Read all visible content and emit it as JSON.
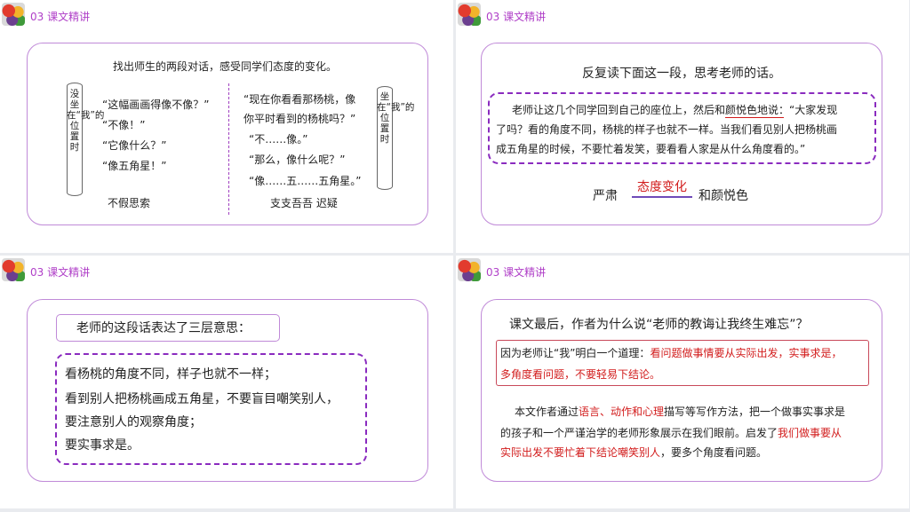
{
  "section_label": "03  课文精讲",
  "slide1": {
    "instruction": "找出师生的两段对话，感受同学们态度的变化。",
    "left_scroll": "没坐在“我”的位置时",
    "left_lines": [
      "“这幅画画得像不像？”",
      "“不像！”",
      "“它像什么？”",
      "“像五角星！”"
    ],
    "left_summary": "不假思索",
    "right_lines": [
      "“现在你看看那杨桃，像",
      "你平时看到的杨桃吗？”",
      "“不……像。”",
      "“那么，像什么呢？”",
      "“像……五……五角星。”"
    ],
    "right_scroll": "坐在“我”的位置时",
    "right_summary": "支支吾吾 迟疑"
  },
  "slide2": {
    "question": "反复读下面这一段，思考老师的话。",
    "para_lines": [
      "老师让这几个同学回到自己的座位上，然后和颜悦色地说：“大家发现",
      "了吗？看的角度不同，杨桃的样子也就不一样。当我们看见别人把杨桃画",
      "成五角星的时候，不要忙着发笑，要看看人家是从什么角度看的。”"
    ],
    "left_word": "严肃",
    "middle_word": "态度变化",
    "right_word": "和颜悦色"
  },
  "slide3": {
    "heading": "老师的这段话表达了三层意思：",
    "points": [
      "看杨桃的角度不同，样子也就不一样；",
      "看到别人把杨桃画成五角星，不要盲目嘲笑别人，",
      "要注意别人的观察角度；",
      "要实事求是。"
    ]
  },
  "slide4": {
    "question": "课文最后，作者为什么说“老师的教诲让我终生难忘”？",
    "answer_prefix": "因为老师让“我”明白一个道理：",
    "answer_red1": "看问题做事情要从实际出发，实事求是，",
    "answer_red2": "多角度看问题，不要轻易下结论。",
    "summary_a": "本文作者通过",
    "summary_b": "语言、动作和心理",
    "summary_c": "描写等写作方法，把一个做事实事求是",
    "summary_line2": "的孩子和一个严谨治学的老师形象展示在我们眼前。启发了",
    "summary_red2": "我们做事要从",
    "summary_red3": "实际出发不要忙着下结论嘲笑别人",
    "summary_line3_tail": "，要多个角度看问题。"
  },
  "colors": {
    "accent_purple": "#b040c8",
    "emphasis_red": "#d21c1c",
    "dash_purple": "#8a2bbf"
  }
}
